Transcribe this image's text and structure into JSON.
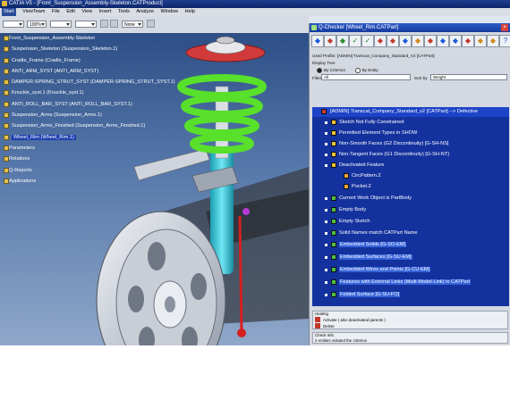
{
  "window": {
    "title": "CATIA V5 - [Front_Suspension_Assembly-Skeleton.CATProduct]"
  },
  "menu": [
    "Start",
    "ViewTeam",
    "File",
    "Edit",
    "View",
    "Insert",
    "Tools",
    "Analyze",
    "Window",
    "Help"
  ],
  "toolbar": {
    "combo1": "",
    "zoom": "100%",
    "combo3": "",
    "combo4": "",
    "combo5": "None"
  },
  "tree": [
    {
      "label": "Front_Suspension_Assembly-Skeleton",
      "level": 0
    },
    {
      "label": "Suspension_Skeleton (Suspension_Skeleton.1)",
      "level": 1
    },
    {
      "label": "Cradle_Frame (Cradle_Frame)",
      "level": 1
    },
    {
      "label": "ANTI_ARM_SYST (ANTI_ARM_SYST)",
      "level": 1
    },
    {
      "label": "DAMPER-SPRING_STRUT_SYST (DAMPER-SPRING_STRUT_SYST.1)",
      "level": 1
    },
    {
      "label": "Knuckle_syst.1 (Knuckle_syst.1)",
      "level": 1
    },
    {
      "label": "ANTI_ROLL_BAR_SYST (ANTI_ROLL_BAR_SYST.1)",
      "level": 1
    },
    {
      "label": "Suspension_Arms (Suspension_Arms.1)",
      "level": 1
    },
    {
      "label": "Suspension_Arms_Finished (Suspension_Arms_Finished.1)",
      "level": 1
    },
    {
      "label": "Wheel_Rim (Wheel_Rim.1)",
      "level": 1,
      "selected": true
    },
    {
      "label": "Parameters",
      "level": 0
    },
    {
      "label": "Relations",
      "level": 0
    },
    {
      "label": "Q-Reports",
      "level": 0
    },
    {
      "label": "Applications",
      "level": 0
    }
  ],
  "checker": {
    "title": "Q-Checker [Wheel_Rim.CATPart]",
    "close": "×",
    "tools": [
      "◆",
      "◆",
      "◆",
      "✓",
      "✓",
      "◆",
      "◆",
      "◆",
      "◆",
      "◆",
      "◆",
      "◆",
      "◆",
      "◆",
      "◆",
      "?"
    ],
    "used_profile_label": "Used Profile:",
    "used_profile_value": "[ADMIN] Transcat_Company_Standard_V2 [CATPart]",
    "display_tree_label": "Display Tree",
    "radio1": "By Criterion",
    "radio2": "By Entity",
    "filter_label": "Filter",
    "filter_value": "All",
    "sort_label": "Sort by",
    "sort_value": "Weight",
    "rules": [
      {
        "label": "[ADMIN] Transcat_Company_Standard_v2 [CATPart] --> Defective",
        "indent": 0,
        "icon": "header-icon",
        "color": "#c93a2e",
        "header": true
      },
      {
        "label": "Sketch Not Fully Constrained",
        "indent": 1,
        "icon": "rule-icon",
        "color": "#e8c23c"
      },
      {
        "label": "Permitted Element Types in SHOW",
        "indent": 1,
        "icon": "rule-icon",
        "color": "#e8c23c"
      },
      {
        "label": "Non-Smooth Faces (G2 Discontinuity) [G-SH-NS]",
        "indent": 1,
        "icon": "rule-icon",
        "color": "#e8c23c"
      },
      {
        "label": "Non-Tangent Faces (G1 Discontinuity) [G-SH-NT]",
        "indent": 1,
        "icon": "rule-icon",
        "color": "#e8c23c"
      },
      {
        "label": "Deactivated Feature",
        "indent": 1,
        "icon": "rule-icon",
        "color": "#e8c23c"
      },
      {
        "label": "CircPattern.2",
        "indent": 2,
        "icon": "feature-icon",
        "color": "#e8a23c"
      },
      {
        "label": "Pocket.2",
        "indent": 2,
        "icon": "feature-icon",
        "color": "#e8a23c"
      },
      {
        "label": "Current Work Object is PartBody",
        "indent": 1,
        "icon": "rule-icon",
        "color": "#4fbf4a"
      },
      {
        "label": "Empty Body",
        "indent": 1,
        "icon": "rule-icon",
        "color": "#4fbf4a"
      },
      {
        "label": "Empty Sketch",
        "indent": 1,
        "icon": "rule-icon",
        "color": "#4fbf4a"
      },
      {
        "label": "Solid Names match CATPart Name",
        "indent": 1,
        "icon": "rule-icon",
        "color": "#4fbf4a"
      },
      {
        "label": "Embedded Solids [G-SO-EM]",
        "indent": 1,
        "icon": "rule-icon",
        "color": "#4fbf4a",
        "highlight": true
      },
      {
        "label": "Embedded Surfaces [G-SU-EM]",
        "indent": 1,
        "icon": "rule-icon",
        "color": "#4fbf4a",
        "highlight": true
      },
      {
        "label": "Embedded Wires and Points [G-CU-EM]",
        "indent": 1,
        "icon": "rule-icon",
        "color": "#4fbf4a",
        "highlight": true
      },
      {
        "label": "Features with External Links (Multi-Model-Link) in CATPart",
        "indent": 1,
        "icon": "rule-icon",
        "color": "#4fbf4a",
        "highlight": true
      },
      {
        "label": "Folded Surface [G-SU-FO]",
        "indent": 1,
        "icon": "rule-icon",
        "color": "#4fbf4a",
        "highlight": true
      }
    ],
    "healing_label": "Healing",
    "heal_action1": "Activate ( also deactivated parents )",
    "heal_action2": "Delete",
    "check_info_label": "Check Info",
    "check_info_value": "2 entities violated the criterion"
  }
}
